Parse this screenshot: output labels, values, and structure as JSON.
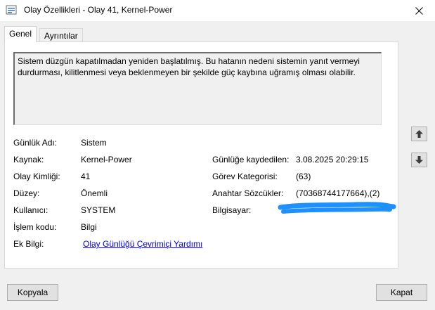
{
  "window": {
    "title": "Olay Özellikleri - Olay 41, Kernel-Power"
  },
  "tabs": [
    {
      "label": "Genel",
      "active": true
    },
    {
      "label": "Ayrıntılar",
      "active": false
    }
  ],
  "description": "Sistem düzgün kapatılmadan yeniden başlatılmış. Bu hatanın nedeni sistemin yanıt vermeyi durdurması, kilitlenmesi veya beklenmeyen bir şekilde güç kaybına uğramış olması olabilir.",
  "fields": {
    "log_name": {
      "label": "Günlük Adı:",
      "value": "Sistem"
    },
    "source": {
      "label": "Kaynak:",
      "value": "Kernel-Power"
    },
    "event_id": {
      "label": "Olay Kimliği:",
      "value": "41"
    },
    "level": {
      "label": "Düzey:",
      "value": "Önemli"
    },
    "user": {
      "label": "Kullanıcı:",
      "value": "SYSTEM"
    },
    "opcode": {
      "label": "İşlem kodu:",
      "value": "Bilgi"
    },
    "more_info": {
      "label": "Ek Bilgi:",
      "value": "Olay Günlüğü Çevrimiçi Yardımı"
    },
    "logged": {
      "label": "Günlüğe kaydedilen:",
      "value": "3.08.2025 20:29:15"
    },
    "task_category": {
      "label": "Görev Kategorisi:",
      "value": "(63)"
    },
    "keywords": {
      "label": "Anahtar Sözcükler:",
      "value": "(70368744177664),(2)"
    },
    "computer": {
      "label": "Bilgisayar:",
      "value": ""
    }
  },
  "buttons": {
    "copy": "Kopyala",
    "close": "Kapat"
  },
  "icons": {
    "window": "event-viewer-icon",
    "close": "close-icon",
    "up": "arrow-up-icon",
    "down": "arrow-down-icon"
  },
  "colors": {
    "redaction": "#1e90ff",
    "link": "#0000ee"
  }
}
